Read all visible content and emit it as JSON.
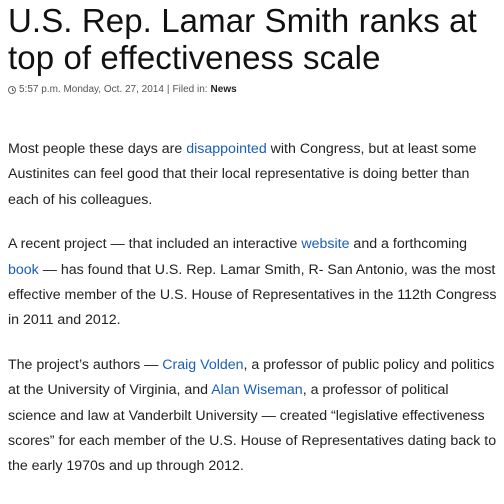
{
  "article": {
    "headline": "U.S. Rep. Lamar Smith ranks at top of effectiveness scale",
    "meta": {
      "icon": "clock-icon",
      "timestamp": "5:57 p.m. Monday, Oct. 27, 2014",
      "separator": "|",
      "filed_label": "Filed in:",
      "category": "News"
    },
    "paragraphs": [
      {
        "t1": "Most people these days are ",
        "link1": "disappointed",
        "t2": " with Congress, but at least some Austinites can feel good that their local representative is doing better than each of his colleagues."
      },
      {
        "t1": "A recent project — that included an interactive ",
        "link1": "website",
        "t2": " and a forthcoming ",
        "link2": "book",
        "t3": " — has found that U.S. Rep. Lamar Smith, R- San Antonio, was the most effective member of the U.S. House of Representatives in the 112th Congress in 2011 and 2012."
      },
      {
        "t1": "The project’s authors — ",
        "link1": "Craig Volden",
        "t2": ", a professor of public policy and politics at the University of Virginia, and ",
        "link2": "Alan Wiseman",
        "t3": ", a professor of political science and law at Vanderbilt University — created “legislative effectiveness scores” for each member of the U.S. House of Representatives dating back to the early 1970s and up through 2012."
      }
    ]
  },
  "colors": {
    "link": "#1a5fb4",
    "text": "#222222",
    "meta_text": "#555555"
  }
}
